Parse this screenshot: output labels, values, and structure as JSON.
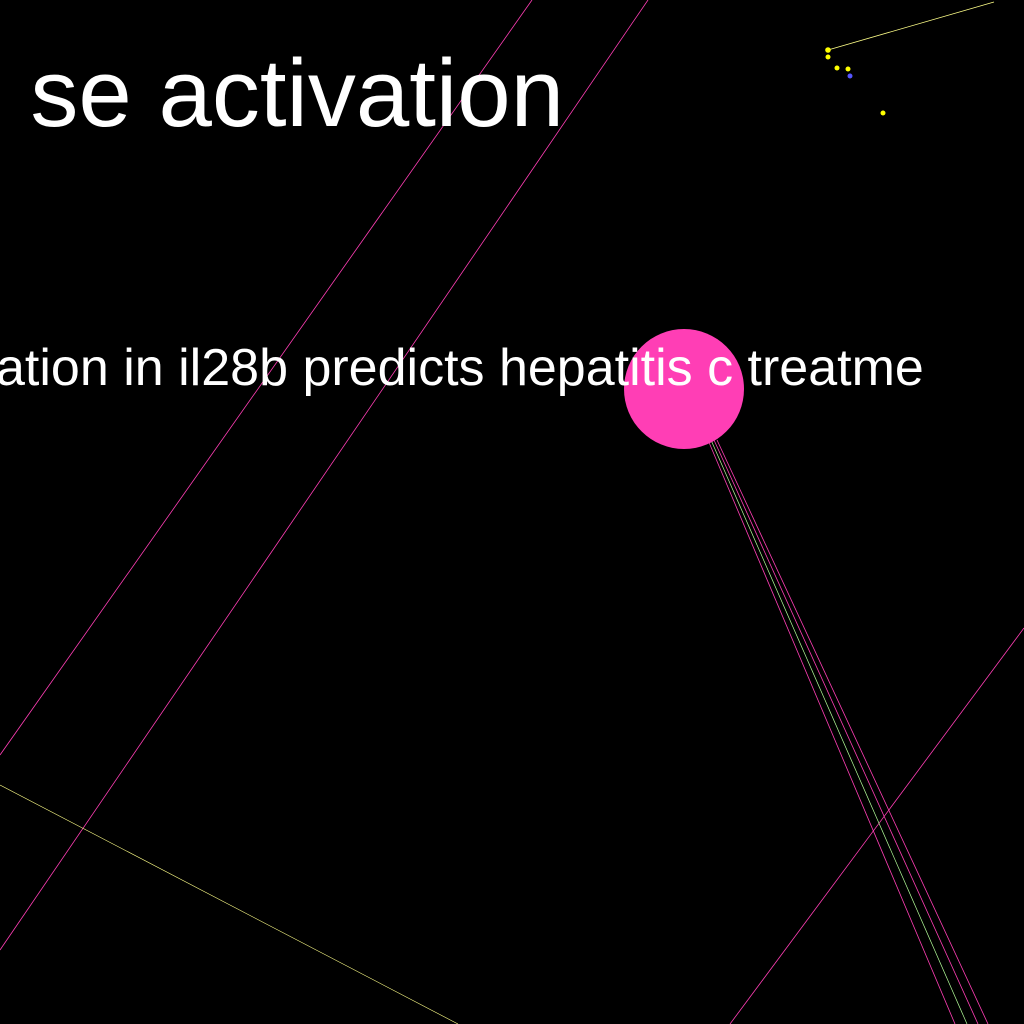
{
  "graph": {
    "background": "#000000",
    "node_colors": {
      "primary": "#ff3eb5",
      "minor": "#ffff00",
      "accent": "#5555ff"
    },
    "edge_colors": {
      "magenta": "#ff3eb5",
      "yellow": "#ffff88",
      "green": "#b4ff9a"
    },
    "labels": {
      "top": "se activation",
      "middle": "ation in il28b predicts hepatitis c treatme"
    }
  }
}
